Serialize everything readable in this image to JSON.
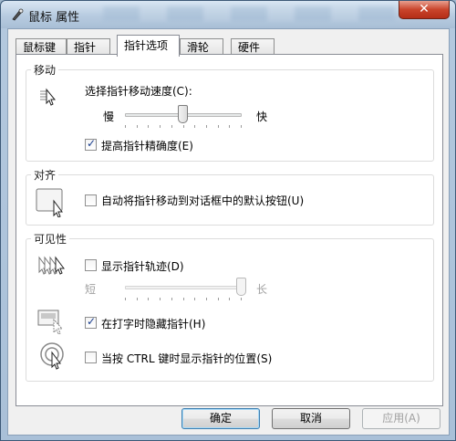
{
  "window": {
    "title": "鼠标 属性",
    "close_glyph": "✕",
    "title_icon": "mouse-icon"
  },
  "tabs": [
    {
      "label": "鼠标键"
    },
    {
      "label": "指针"
    },
    {
      "label": "指针选项",
      "active": true
    },
    {
      "label": "滑轮"
    },
    {
      "label": "硬件"
    }
  ],
  "motion": {
    "title": "移动",
    "speed_label": "选择指针移动速度(C):",
    "slow": "慢",
    "fast": "快",
    "speed_level": 0.5,
    "precision_label": "提高指针精确度(E)",
    "precision_checked": true
  },
  "snap": {
    "title": "对齐",
    "label": "自动将指针移动到对话框中的默认按钮(U)",
    "checked": false
  },
  "visibility": {
    "title": "可见性",
    "trails_label": "显示指针轨迹(D)",
    "trails_checked": false,
    "short": "短",
    "long": "长",
    "trails_level": 1.0,
    "hide_label": "在打字时隐藏指针(H)",
    "hide_checked": true,
    "ctrl_label": "当按 CTRL 键时显示指针的位置(S)",
    "ctrl_checked": false
  },
  "buttons": {
    "ok": "确定",
    "cancel": "取消",
    "apply": "应用(A)"
  }
}
